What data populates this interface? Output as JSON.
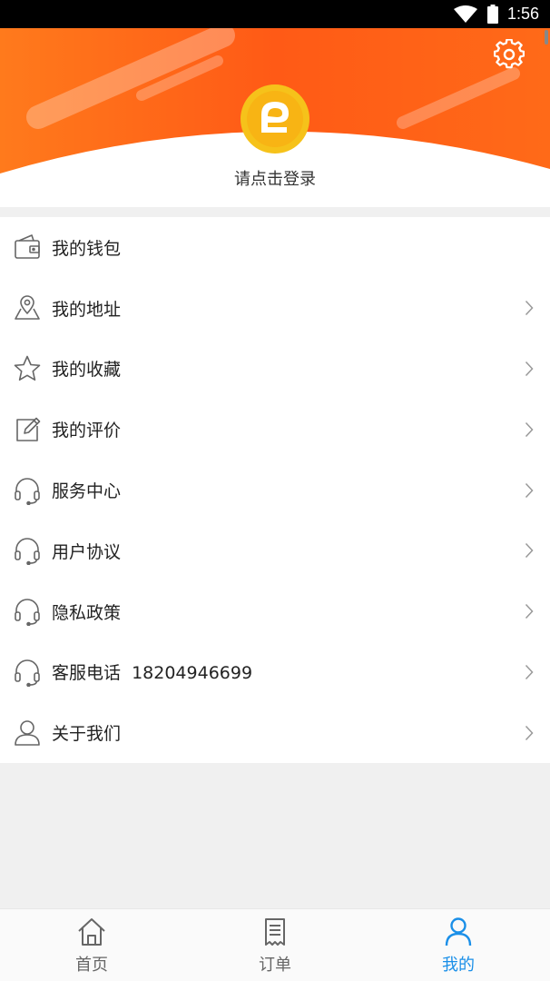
{
  "status_bar": {
    "time": "1:56"
  },
  "header": {
    "login_text": "请点击登录"
  },
  "menu": {
    "items": [
      {
        "label": "我的钱包",
        "icon": "wallet-icon",
        "chevron": false
      },
      {
        "label": "我的地址",
        "icon": "location-icon",
        "chevron": true
      },
      {
        "label": "我的收藏",
        "icon": "star-icon",
        "chevron": true
      },
      {
        "label": "我的评价",
        "icon": "edit-icon",
        "chevron": true
      },
      {
        "label": "服务中心",
        "icon": "headset-icon",
        "chevron": true
      },
      {
        "label": "用户协议",
        "icon": "headset-icon",
        "chevron": true
      },
      {
        "label": "隐私政策",
        "icon": "headset-icon",
        "chevron": true
      },
      {
        "label": "客服电话  18204946699",
        "icon": "headset-icon",
        "chevron": true
      },
      {
        "label": "关于我们",
        "icon": "user-icon",
        "chevron": true
      }
    ]
  },
  "tabbar": {
    "tabs": [
      {
        "label": "首页",
        "icon": "home-icon",
        "active": false
      },
      {
        "label": "订单",
        "icon": "order-icon",
        "active": false
      },
      {
        "label": "我的",
        "icon": "profile-icon",
        "active": true
      }
    ]
  },
  "colors": {
    "accent": "#1a8fe8",
    "header_orange": "#ff6a1a",
    "logo_yellow": "#f5c518"
  }
}
